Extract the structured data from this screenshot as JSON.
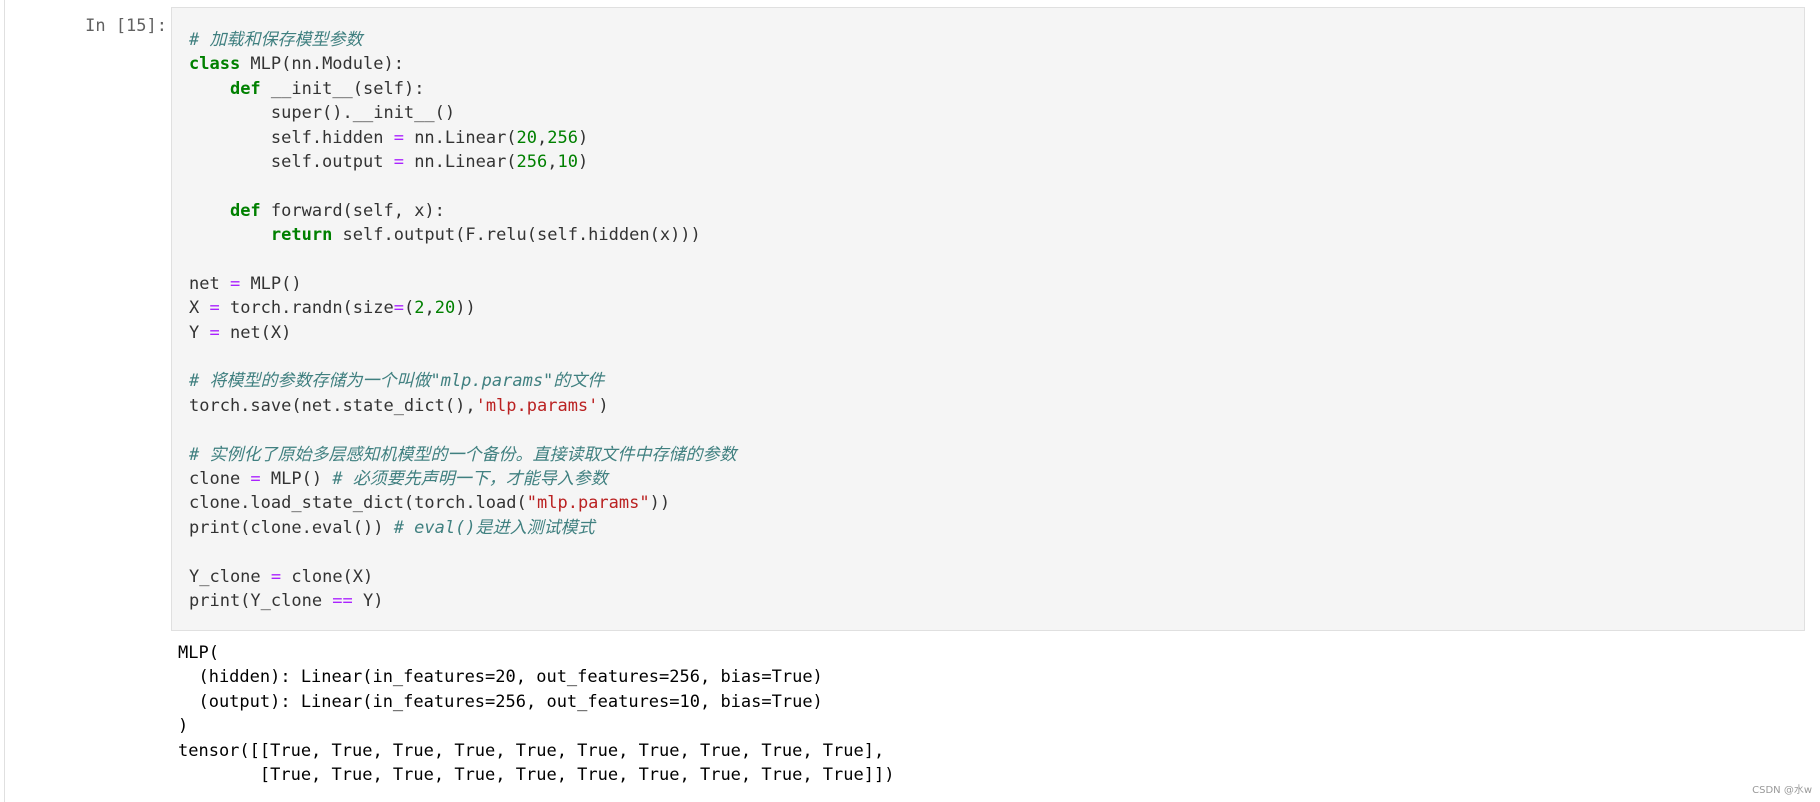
{
  "cell": {
    "prompt": "In [15]:",
    "code_lines": [
      [
        {
          "t": "# 加载和保存模型参数",
          "c": "cm"
        }
      ],
      [
        {
          "t": "class",
          "c": "kw"
        },
        {
          "t": " MLP(nn.Module):"
        }
      ],
      [
        {
          "t": "    "
        },
        {
          "t": "def",
          "c": "kw"
        },
        {
          "t": " __init__(self):"
        }
      ],
      [
        {
          "t": "        super().__init__()"
        }
      ],
      [
        {
          "t": "        self.hidden "
        },
        {
          "t": "=",
          "c": "op"
        },
        {
          "t": " nn.Linear("
        },
        {
          "t": "20",
          "c": "num"
        },
        {
          "t": ","
        },
        {
          "t": "256",
          "c": "num"
        },
        {
          "t": ")"
        }
      ],
      [
        {
          "t": "        self.output "
        },
        {
          "t": "=",
          "c": "op"
        },
        {
          "t": " nn.Linear("
        },
        {
          "t": "256",
          "c": "num"
        },
        {
          "t": ","
        },
        {
          "t": "10",
          "c": "num"
        },
        {
          "t": ")"
        }
      ],
      [
        {
          "t": ""
        }
      ],
      [
        {
          "t": "    "
        },
        {
          "t": "def",
          "c": "kw"
        },
        {
          "t": " forward(self, x):"
        }
      ],
      [
        {
          "t": "        "
        },
        {
          "t": "return",
          "c": "kw"
        },
        {
          "t": " self.output(F.relu(self.hidden(x)))"
        }
      ],
      [
        {
          "t": ""
        }
      ],
      [
        {
          "t": "net "
        },
        {
          "t": "=",
          "c": "op"
        },
        {
          "t": " MLP()"
        }
      ],
      [
        {
          "t": "X "
        },
        {
          "t": "=",
          "c": "op"
        },
        {
          "t": " torch.randn(size"
        },
        {
          "t": "=",
          "c": "op"
        },
        {
          "t": "("
        },
        {
          "t": "2",
          "c": "num"
        },
        {
          "t": ","
        },
        {
          "t": "20",
          "c": "num"
        },
        {
          "t": "))"
        }
      ],
      [
        {
          "t": "Y "
        },
        {
          "t": "=",
          "c": "op"
        },
        {
          "t": " net(X)"
        }
      ],
      [
        {
          "t": ""
        }
      ],
      [
        {
          "t": "# 将模型的参数存储为一个叫做\"mlp.params\"的文件",
          "c": "cm"
        }
      ],
      [
        {
          "t": "torch.save(net.state_dict(),"
        },
        {
          "t": "'mlp.params'",
          "c": "str"
        },
        {
          "t": ")"
        }
      ],
      [
        {
          "t": ""
        }
      ],
      [
        {
          "t": "# 实例化了原始多层感知机模型的一个备份。直接读取文件中存储的参数",
          "c": "cm"
        }
      ],
      [
        {
          "t": "clone "
        },
        {
          "t": "=",
          "c": "op"
        },
        {
          "t": " MLP() "
        },
        {
          "t": "# 必须要先声明一下，才能导入参数",
          "c": "cm"
        }
      ],
      [
        {
          "t": "clone.load_state_dict(torch.load("
        },
        {
          "t": "\"mlp.params\"",
          "c": "str"
        },
        {
          "t": "))"
        }
      ],
      [
        {
          "t": "print(clone.eval()) "
        },
        {
          "t": "# eval()是进入测试模式",
          "c": "cm"
        }
      ],
      [
        {
          "t": ""
        }
      ],
      [
        {
          "t": "Y_clone "
        },
        {
          "t": "=",
          "c": "op"
        },
        {
          "t": " clone(X)"
        }
      ],
      [
        {
          "t": "print(Y_clone "
        },
        {
          "t": "==",
          "c": "op"
        },
        {
          "t": " Y)"
        }
      ]
    ],
    "output_lines": [
      "MLP(",
      "  (hidden): Linear(in_features=20, out_features=256, bias=True)",
      "  (output): Linear(in_features=256, out_features=10, bias=True)",
      ")",
      "tensor([[True, True, True, True, True, True, True, True, True, True],",
      "        [True, True, True, True, True, True, True, True, True, True]])"
    ]
  },
  "watermark": "CSDN @水w"
}
